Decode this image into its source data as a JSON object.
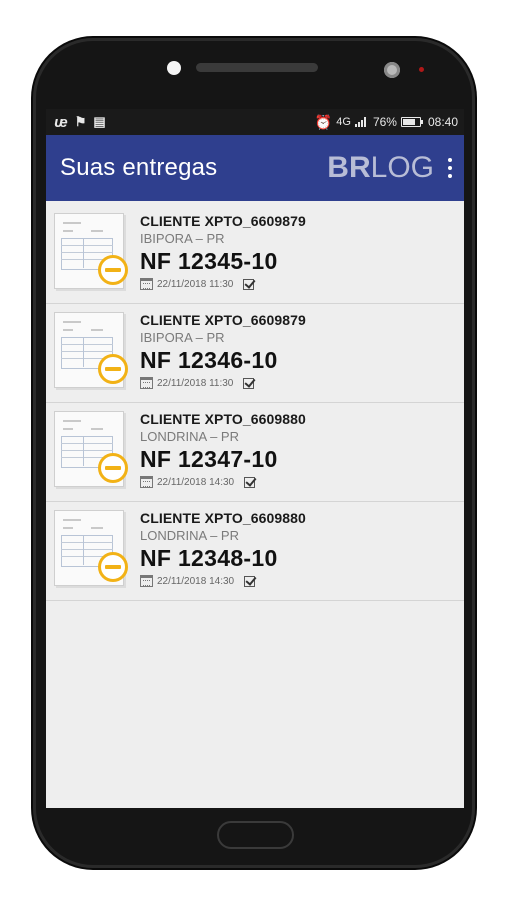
{
  "status_bar": {
    "left_icons": [
      "u-app-icon",
      "flag-icon",
      "message-icon"
    ],
    "network": "4G",
    "battery": "76%",
    "battery_level": 0.76,
    "time": "08:40"
  },
  "app_bar": {
    "title": "Suas entregas",
    "logo_bold": "BR",
    "logo_light": "LOG"
  },
  "deliveries": [
    {
      "client": "CLIENTE XPTO_6609879",
      "city": "IBIPORA – PR",
      "nf": "NF 12345-10",
      "datetime": "22/11/2018 11:30"
    },
    {
      "client": "CLIENTE XPTO_6609879",
      "city": "IBIPORA – PR",
      "nf": "NF 12346-10",
      "datetime": "22/11/2018 11:30"
    },
    {
      "client": "CLIENTE XPTO_6609880",
      "city": "LONDRINA – PR",
      "nf": "NF 12347-10",
      "datetime": "22/11/2018 14:30"
    },
    {
      "client": "CLIENTE XPTO_6609880",
      "city": "LONDRINA – PR",
      "nf": "NF 12348-10",
      "datetime": "22/11/2018 14:30"
    }
  ],
  "colors": {
    "app_bar": "#2f3f8e",
    "status_bar": "#1a1a1a",
    "pending_accent": "#f2b216",
    "list_background": "#eeeeee"
  }
}
